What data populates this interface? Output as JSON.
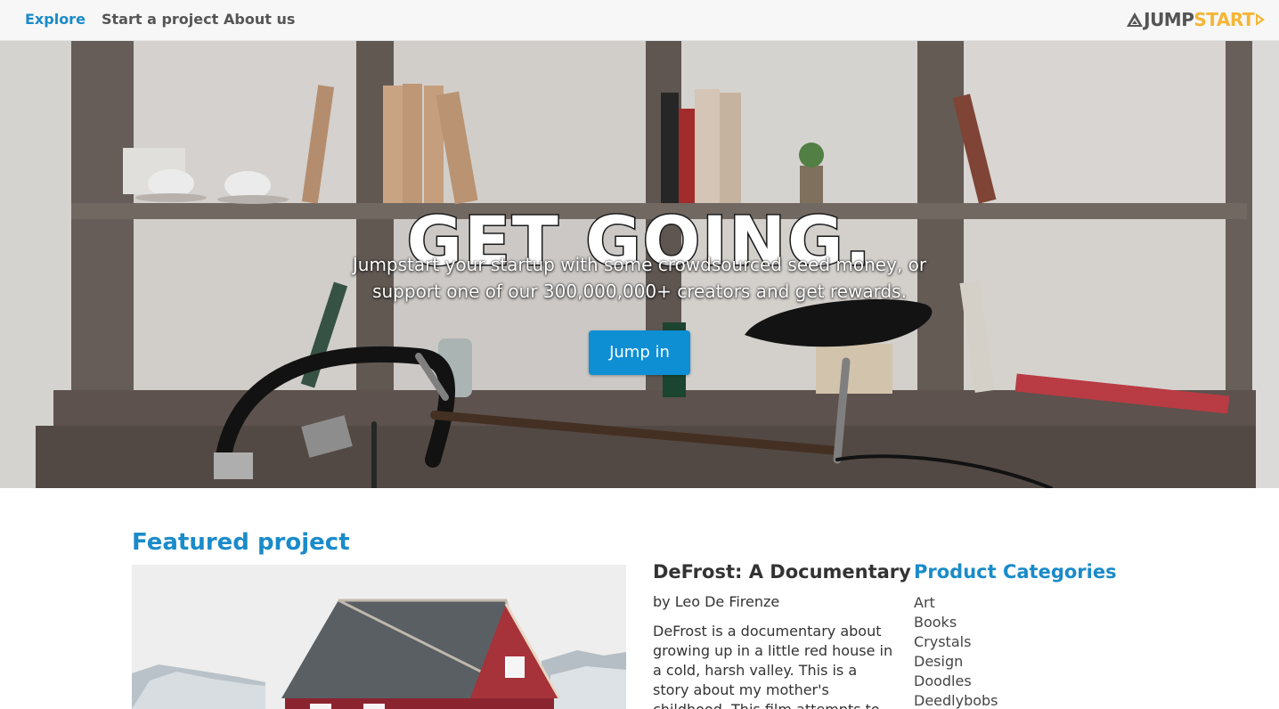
{
  "nav": {
    "items": [
      {
        "label": "Explore",
        "active": true
      },
      {
        "label": "Start a project",
        "active": false
      },
      {
        "label": "About us",
        "active": false
      }
    ],
    "logo": {
      "part1": "JUMP",
      "part2": "START",
      "icon": "triangle-arrow-icon"
    }
  },
  "hero": {
    "title": "GET GOING.",
    "subtitle": "Jumpstart your startup with some crowdsourced seed money, or support one of our 300,000,000+ creators and get rewards.",
    "button_label": "Jump in"
  },
  "featured": {
    "heading": "Featured project",
    "title": "DeFrost: A Documentary",
    "author": "by Leo De Firenze",
    "description": "DeFrost is a documentary about growing up in a little red house in a cold, harsh valley. This is a story about my mother's childhood. This film attempts to capture vignettes"
  },
  "categories": {
    "heading": "Product Categories",
    "items": [
      "Art",
      "Books",
      "Crystals",
      "Design",
      "Doodles",
      "Deedlybobs"
    ]
  },
  "colors": {
    "accent": "#1a8bc9",
    "button": "#0e8fd4",
    "logo_yellow": "#f5b634",
    "nav_bg": "#f7f7f7"
  }
}
